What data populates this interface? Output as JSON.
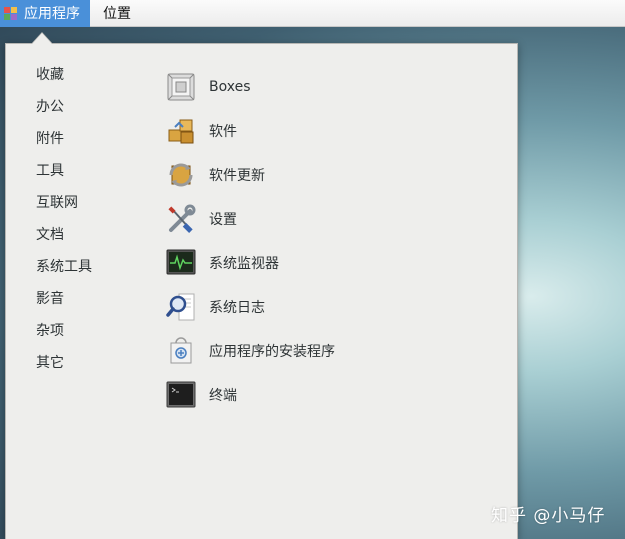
{
  "topbar": {
    "applications_label": "应用程序",
    "places_label": "位置"
  },
  "menu": {
    "categories": [
      {
        "label": "收藏"
      },
      {
        "label": "办公"
      },
      {
        "label": "附件"
      },
      {
        "label": "工具"
      },
      {
        "label": "互联网"
      },
      {
        "label": "文档"
      },
      {
        "label": "系统工具"
      },
      {
        "label": "影音"
      },
      {
        "label": "杂项"
      },
      {
        "label": "其它"
      }
    ],
    "apps": [
      {
        "label": "Boxes",
        "icon": "boxes-icon"
      },
      {
        "label": "软件",
        "icon": "software-icon"
      },
      {
        "label": "软件更新",
        "icon": "software-update-icon"
      },
      {
        "label": "设置",
        "icon": "settings-tools-icon"
      },
      {
        "label": "系统监视器",
        "icon": "system-monitor-icon"
      },
      {
        "label": "系统日志",
        "icon": "system-log-icon"
      },
      {
        "label": "应用程序的安装程序",
        "icon": "package-installer-icon"
      },
      {
        "label": "终端",
        "icon": "terminal-icon"
      }
    ]
  },
  "watermark": "知乎 @小马仔",
  "colors": {
    "accent": "#4a90d9",
    "menu_background": "#eeeeec"
  }
}
